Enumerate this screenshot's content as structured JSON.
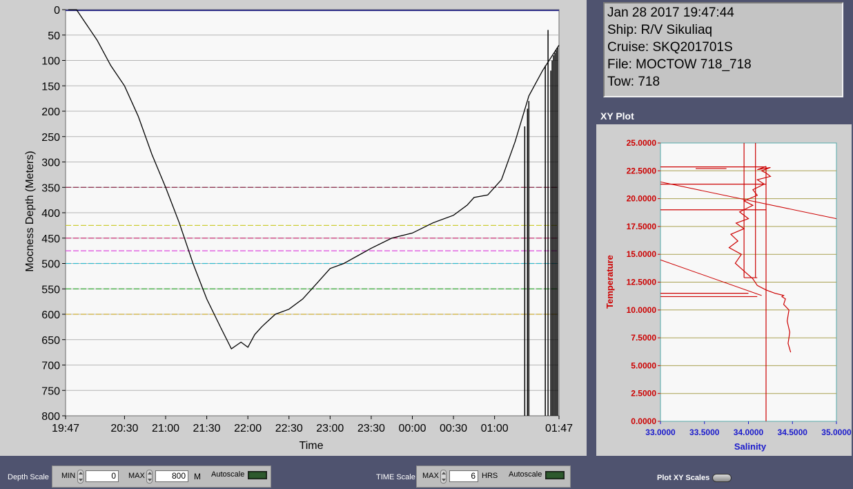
{
  "info": {
    "datetime": "Jan 28 2017 19:47:44",
    "ship": "Ship: R/V Sikuliaq",
    "cruise": "Cruise: SKQ201701S",
    "file": "File: MOCTOW 718_718",
    "tow": "Tow: 718"
  },
  "xy_plot": {
    "title": "XY Plot"
  },
  "controls": {
    "depth_scale_label": "Depth Scale",
    "min_label": "MIN",
    "min_value": "0",
    "max_label": "MAX",
    "max_value": "800",
    "depth_unit": "M",
    "autoscale_label": "Autoscale",
    "time_scale_label": "TIME Scale",
    "time_max_label": "MAX",
    "time_max_value": "6",
    "time_unit": "HRS",
    "time_autoscale_label": "Autoscale",
    "plot_xy_scales_label": "Plot XY Scales"
  },
  "colors": {
    "background": "#4f536f",
    "depth_trace": "#000000",
    "xy_trace": "#cc0000",
    "plot_bg": "#f8f8f8",
    "axis_blue": "#1a1acc",
    "axis_red": "#cc0000"
  },
  "chart_data": [
    {
      "type": "line",
      "xlabel": "Time",
      "ylabel": "Mocness Depth (Meters)",
      "xlim": [
        "19:47",
        "01:47"
      ],
      "ylim": [
        0,
        800
      ],
      "y_inverted": true,
      "x_tick_labels": [
        "19:47",
        "20:30",
        "21:00",
        "21:30",
        "22:00",
        "22:30",
        "23:00",
        "23:30",
        "00:00",
        "00:30",
        "01:00",
        "01:47"
      ],
      "y_ticks": [
        0,
        50,
        100,
        150,
        200,
        250,
        300,
        350,
        400,
        450,
        500,
        550,
        600,
        650,
        700,
        750,
        800
      ],
      "grid": true,
      "reference_lines": [
        {
          "depth": 350,
          "color": "#8b2a4a"
        },
        {
          "depth": 425,
          "color": "#cccc33"
        },
        {
          "depth": 450,
          "color": "#cc3377"
        },
        {
          "depth": 475,
          "color": "#dd44dd"
        },
        {
          "depth": 500,
          "color": "#33bbcc"
        },
        {
          "depth": 550,
          "color": "#33aa33"
        },
        {
          "depth": 600,
          "color": "#ccaa33"
        }
      ],
      "series": [
        {
          "x": [
            "19:49",
            "19:55",
            "20:00",
            "20:10",
            "20:20",
            "20:30",
            "20:40",
            "20:50",
            "21:00",
            "21:10",
            "21:20",
            "21:30",
            "21:40",
            "21:48",
            "21:55",
            "22:00",
            "22:05",
            "22:10",
            "22:20",
            "22:30",
            "22:40",
            "22:50",
            "23:00",
            "23:10",
            "23:20",
            "23:30",
            "23:45",
            "00:00",
            "00:15",
            "00:30",
            "00:40",
            "00:45",
            "00:55",
            "01:05",
            "01:15",
            "01:25",
            "01:35",
            "01:47"
          ],
          "y": [
            0,
            0,
            20,
            60,
            110,
            150,
            210,
            285,
            350,
            420,
            500,
            570,
            625,
            668,
            655,
            665,
            640,
            625,
            600,
            590,
            570,
            540,
            510,
            500,
            485,
            470,
            450,
            440,
            420,
            405,
            385,
            370,
            365,
            335,
            260,
            170,
            120,
            70
          ]
        }
      ],
      "spikes_x": [
        "01:22",
        "01:24",
        "01:25",
        "01:37",
        "01:39",
        "01:41",
        "01:42",
        "01:43",
        "01:44",
        "01:45",
        "01:46"
      ],
      "spikes_top": [
        230,
        195,
        180,
        110,
        40,
        120,
        100,
        90,
        85,
        80,
        75
      ]
    },
    {
      "type": "line",
      "title": "XY Plot",
      "xlabel": "Salinity",
      "ylabel": "Temperature",
      "xlim": [
        33,
        35
      ],
      "ylim": [
        0,
        25
      ],
      "x_tick_labels": [
        "33.0000",
        "33.5000",
        "34.0000",
        "34.5000",
        "35.0000"
      ],
      "y_tick_labels": [
        "0.0000",
        "2.5000",
        "5.0000",
        "7.5000",
        "10.0000",
        "12.5000",
        "15.0000",
        "17.5000",
        "20.0000",
        "22.5000",
        "25.0000"
      ],
      "grid": true,
      "series": [
        {
          "x": [
            34.48,
            34.45,
            34.47,
            34.44,
            34.46,
            34.4,
            34.42,
            34.38,
            34.4,
            34.3,
            34.2,
            34.1,
            34.05,
            33.95,
            33.85,
            33.92,
            33.78,
            33.88,
            33.8,
            33.95,
            33.86,
            34.0,
            33.9,
            34.05,
            33.95,
            34.1,
            34.05,
            34.18,
            34.1,
            34.25,
            34.2,
            34.15,
            34.25,
            34.1,
            34.2
          ],
          "y": [
            6.2,
            7.0,
            8.0,
            9.0,
            10.0,
            10.5,
            11.0,
            11.2,
            11.3,
            11.5,
            11.8,
            12.2,
            12.8,
            13.5,
            14.2,
            15.0,
            15.6,
            16.2,
            16.8,
            17.3,
            17.8,
            18.2,
            18.8,
            19.4,
            19.8,
            20.3,
            20.8,
            21.3,
            21.7,
            22.0,
            22.3,
            22.5,
            22.8,
            22.6,
            22.9
          ]
        }
      ],
      "artifact_lines": [
        {
          "x1": 33.0,
          "y1": 21.5,
          "x2": 35.0,
          "y2": 18.2
        },
        {
          "x1": 33.0,
          "y1": 14.5,
          "x2": 34.15,
          "y2": 11.3
        }
      ],
      "horizontal_segments": [
        {
          "y": 22.85,
          "x1": 33.0,
          "x2": 34.2
        },
        {
          "y": 22.7,
          "x1": 33.4,
          "x2": 33.75
        },
        {
          "y": 21.3,
          "x1": 33.0,
          "x2": 34.2
        },
        {
          "y": 19.0,
          "x1": 33.0,
          "x2": 34.2
        },
        {
          "y": 11.5,
          "x1": 33.0,
          "x2": 34.0
        },
        {
          "y": 11.2,
          "x1": 33.0,
          "x2": 34.1
        },
        {
          "y": 12.9,
          "x1": 33.95,
          "x2": 34.1
        }
      ],
      "vertical_segments": [
        {
          "x": 33.95,
          "y1": 12.9,
          "y2": 25.0
        },
        {
          "x": 34.08,
          "y1": 12.9,
          "y2": 25.0
        },
        {
          "x": 34.2,
          "y1": 0.0,
          "y2": 22.9
        }
      ]
    }
  ]
}
